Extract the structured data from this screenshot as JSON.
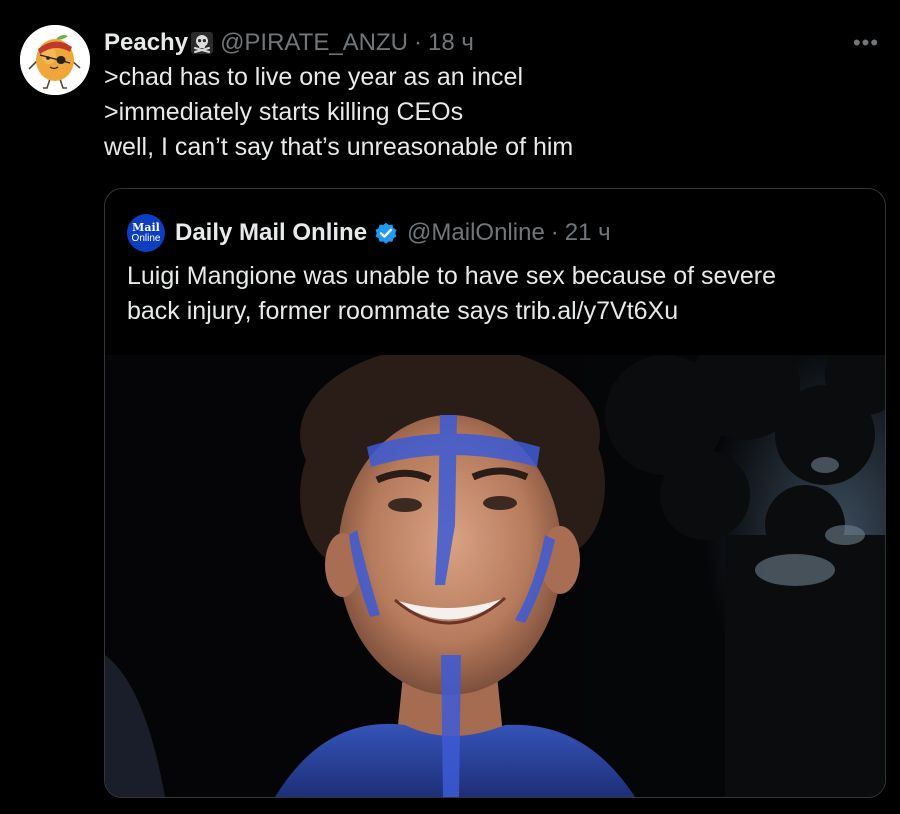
{
  "tweet": {
    "author": {
      "display_name": "Peachy",
      "name_emoji": "skull-and-crossbones-icon",
      "handle": "@PIRATE_ANZU",
      "time": "18 ч"
    },
    "separator": "·",
    "more_label": "•••",
    "lines": [
      ">chad has to live one year as an incel",
      ">immediately starts killing CEOs",
      "well, I can’t say that’s unreasonable of him"
    ]
  },
  "quoted_tweet": {
    "logo": {
      "line1": "Mail",
      "line2": "Online",
      "color": "#0d3ec1"
    },
    "display_name": "Daily Mail Online",
    "verified": true,
    "handle": "@MailOnline",
    "separator": "·",
    "time": "21 ч",
    "lines": [
      "Luigi Mangione was unable to have sex because of severe",
      "back injury, former roommate says trib.al/y7Vt6Xu"
    ],
    "media": {
      "type": "photo",
      "subject": "smiling-young-man-with-blue-face-paint"
    }
  },
  "colors": {
    "background": "#000000",
    "text_primary": "#e7e9ea",
    "text_secondary": "#71767b",
    "border": "#333639",
    "verified_blue": "#1d9bf0"
  }
}
